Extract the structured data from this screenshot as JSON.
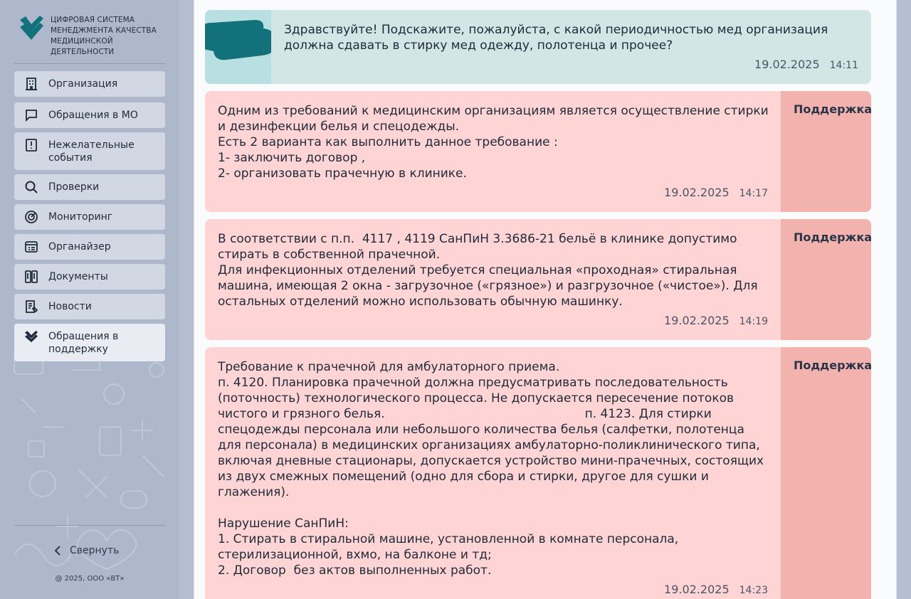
{
  "brand": {
    "lines": [
      "Цифровая система",
      "менеджмента качества",
      "медицинской",
      "деятельности"
    ],
    "colors": {
      "teal": "#12717a",
      "text": "#1f2c44"
    }
  },
  "nav": {
    "items": [
      {
        "label": "Организация",
        "icon": "building-icon"
      },
      {
        "label": "Обращения в МО",
        "icon": "chat-icon"
      },
      {
        "label": "Нежелательные события",
        "icon": "alert-note-icon"
      },
      {
        "label": "Проверки",
        "icon": "search-icon"
      },
      {
        "label": "Мониторинг",
        "icon": "target-icon"
      },
      {
        "label": "Органайзер",
        "icon": "organizer-icon"
      },
      {
        "label": "Документы",
        "icon": "documents-icon"
      },
      {
        "label": "Новости",
        "icon": "news-icon"
      },
      {
        "label": "Обращения в поддержку",
        "icon": "support-check-icon",
        "active": true
      }
    ],
    "collapse_label": "Свернуть",
    "copyright": "@ 2025, ООО «ВТ»"
  },
  "messages": [
    {
      "type": "user",
      "text": "Здравствуйте! Подскажите, пожалуйста, с какой периодичностью мед организация должна сдавать в стирку мед одежду, полотенца и прочее?",
      "date": "19.02.2025",
      "time": "14:11"
    },
    {
      "type": "support",
      "author": "Поддержка",
      "text": "Одним из требований к медицинским организациям является осуществление стирки и дезинфекции белья и спецодежды.\nЕсть 2 варианта как выполнить данное требование :\n1- заключить договор ,\n2- организовать прачечную в клинике.",
      "date": "19.02.2025",
      "time": "14:17"
    },
    {
      "type": "support",
      "author": "Поддержка",
      "text": "В соответствии с п.п.  4117 , 4119 СанПиН 3.3686-21 бельё в клинике допустимо стирать в собственной прачечной.\nДля инфекционных отделений требуется специальная «проходная» стиральная машина, имеющая 2 окна - загрузочное («грязное») и разгрузочное («чистое»). Для остальных отделений можно использовать обычную машинку.",
      "date": "19.02.2025",
      "time": "14:19"
    },
    {
      "type": "support",
      "author": "Поддержка",
      "text": "Требование к прачечной для амбулаторного приема.\nп. 4120. Планировка прачечной должна предусматривать последовательность (поточность) технологического процесса. Не допускается пересечение потоков чистого и грязного белья.                                                    п. 4123. Для стирки спецодежды персонала или небольшого количества белья (салфетки, полотенца для персонала) в медицинских организациях амбулаторно-поликлинического типа, включая дневные стационары, допускается устройство мини-прачечных, состоящих из двух смежных помещений (одно для сбора и стирки, другое для сушки и глажения).\n\nНарушение СанПиН:\n1. Стирать в стиральной машине, установленной в комнате персонала, стерилизационной, вхмо, на балконе и тд;\n2. Договор  без актов выполненных работ.",
      "date": "19.02.2025",
      "time": "14:23"
    }
  ]
}
